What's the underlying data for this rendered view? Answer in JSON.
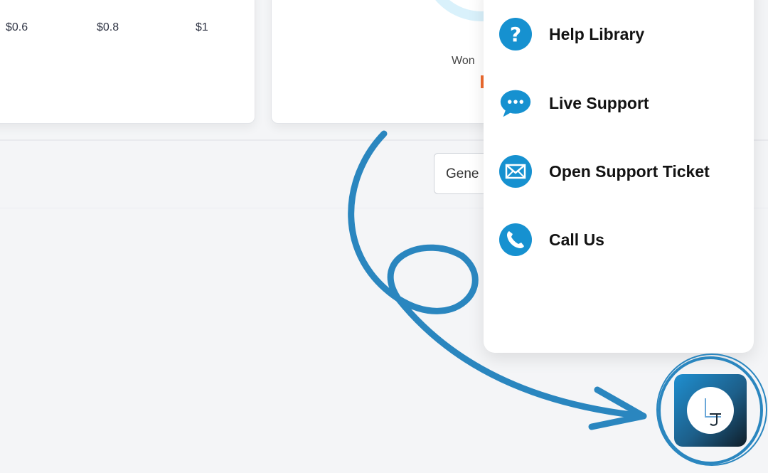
{
  "chart_axis": {
    "ticks": [
      "$0.6",
      "$0.8",
      "$1"
    ]
  },
  "summary": {
    "won_label": "Won"
  },
  "select": {
    "value": "Gene"
  },
  "support_menu": {
    "items": [
      {
        "label": "Help Library",
        "icon": "question-icon"
      },
      {
        "label": "Live Support",
        "icon": "chat-icon"
      },
      {
        "label": "Open Support Ticket",
        "icon": "envelope-icon"
      },
      {
        "label": "Call Us",
        "icon": "phone-icon"
      }
    ]
  },
  "colors": {
    "accent": "#1691d0",
    "annotation": "#2a86bf",
    "won_highlight": "#ef6b2f"
  }
}
